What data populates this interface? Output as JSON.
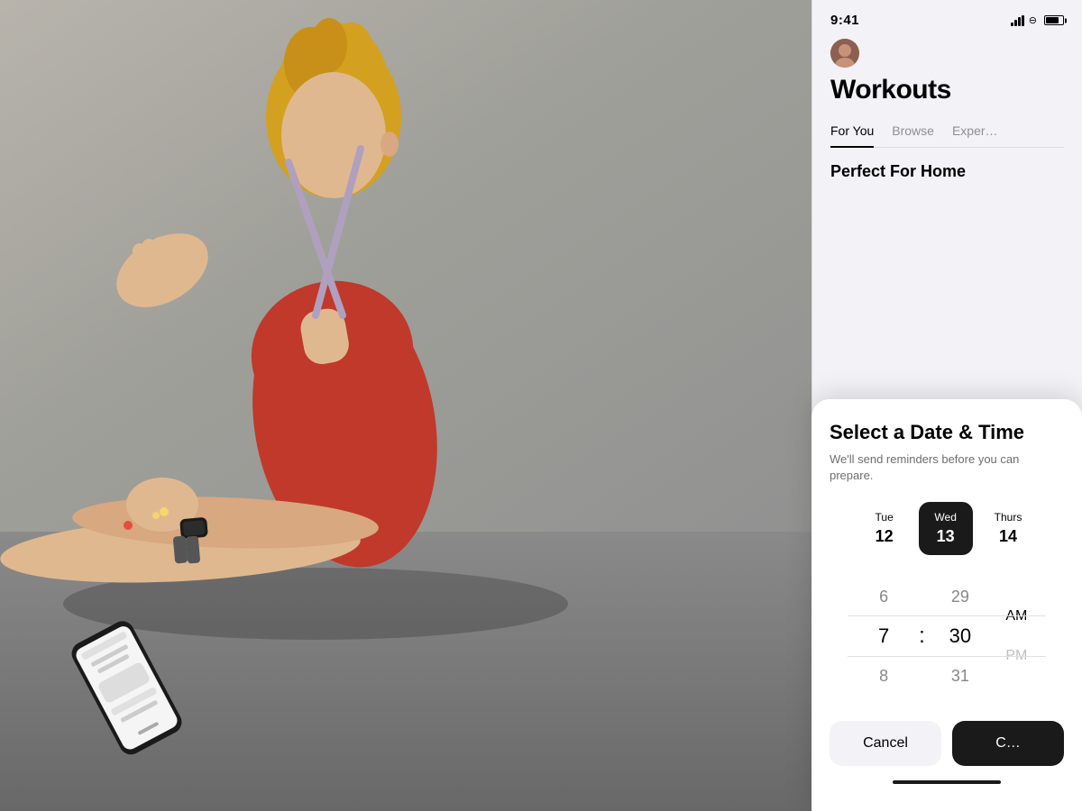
{
  "background": {
    "alt": "Woman in red tank top doing yoga stretch on floor"
  },
  "status_bar": {
    "time": "9:41",
    "signal": true,
    "wifi": true,
    "battery": true
  },
  "app": {
    "title": "Workouts",
    "avatar_alt": "User avatar",
    "tabs": [
      {
        "label": "For You",
        "active": true
      },
      {
        "label": "Browse",
        "active": false
      },
      {
        "label": "Exper…",
        "active": false
      }
    ],
    "section": {
      "title": "Perfect For Home"
    }
  },
  "modal": {
    "title": "Select a Date & Time",
    "subtitle": "We'll send reminders before you can prepare.",
    "dates": [
      {
        "day": "Tue",
        "num": "12",
        "selected": false
      },
      {
        "day": "Wed",
        "num": "13",
        "selected": true
      },
      {
        "day": "Thurs",
        "num": "14",
        "selected": false
      }
    ],
    "time": {
      "hours": [
        "6",
        "7",
        "8"
      ],
      "minutes": [
        "29",
        "30",
        "31"
      ],
      "periods": [
        "AM",
        "PM"
      ],
      "selected_hour": "7",
      "selected_minute": "30",
      "selected_period": "AM"
    },
    "buttons": {
      "cancel": "Cancel",
      "confirm": "C…"
    }
  },
  "phone": {
    "alt": "iPhone on floor showing app"
  }
}
